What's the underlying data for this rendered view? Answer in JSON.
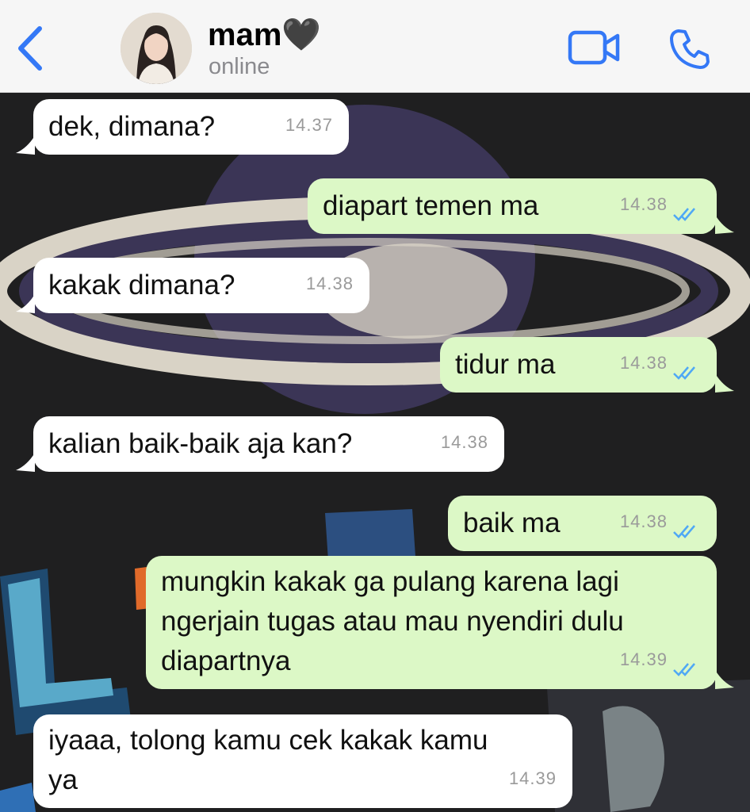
{
  "header": {
    "contact_name": "mam🖤",
    "status": "online",
    "colors": {
      "accent": "#3478f6",
      "background": "#f6f6f6"
    }
  },
  "icons": [
    "chevron-left-icon",
    "video-camera-icon",
    "phone-icon",
    "double-check-icon"
  ],
  "messages": [
    {
      "direction": "in",
      "text": "dek, dimana?",
      "time": "14.37"
    },
    {
      "direction": "out",
      "text": "diapart temen ma",
      "time": "14.38",
      "read": true
    },
    {
      "direction": "in",
      "text": "kakak dimana?",
      "time": "14.38"
    },
    {
      "direction": "out",
      "text": "tidur ma",
      "time": "14.38",
      "read": true
    },
    {
      "direction": "in",
      "text": "kalian baik-baik aja kan?",
      "time": "14.38"
    },
    {
      "direction": "out",
      "text": "baik ma",
      "time": "14.38",
      "read": true
    },
    {
      "direction": "out",
      "lines": [
        "mungkin kakak ga pulang karena lagi",
        "ngerjain tugas atau mau nyendiri dulu",
        "diapartnya"
      ],
      "time": "14.39",
      "read": true
    },
    {
      "direction": "in",
      "lines": [
        "iyaaa, tolong kamu cek kakak kamu",
        "ya"
      ],
      "time": "14.39"
    }
  ],
  "colors": {
    "incoming_bubble": "#ffffff",
    "outgoing_bubble": "#dcf8c6",
    "read_tick": "#4fa8f5"
  }
}
